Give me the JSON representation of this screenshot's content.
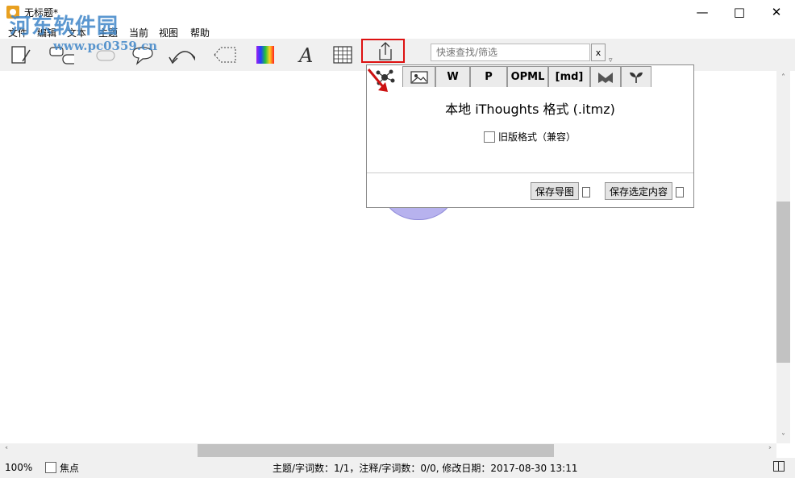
{
  "window": {
    "title": "无标题*"
  },
  "watermark": {
    "site": "河东软件园",
    "url": "www.pc0359.cn"
  },
  "menu": [
    "文件",
    "编辑",
    "文本",
    "主题",
    "当前",
    "视图",
    "帮助"
  ],
  "search": {
    "placeholder": "快速查找/筛选",
    "clear_label": "x"
  },
  "export_panel": {
    "tabs": [
      "",
      "W",
      "P",
      "OPML",
      "[md]",
      "",
      ""
    ],
    "format_title": "本地 iThoughts 格式 (.itmz)",
    "legacy_label": "旧版格式（兼容）",
    "save_map_label": "保存导图",
    "save_selected_label": "保存选定内容"
  },
  "status": {
    "zoom": "100%",
    "focus_label": "焦点",
    "info": "主题/字词数：1/1，注释/字词数：0/0, 修改日期：2017-08-30 13:11"
  },
  "colors": {
    "highlight": "#dd1111",
    "topic_fill": "#b7b2ee",
    "watermark": "#3f86c8"
  }
}
